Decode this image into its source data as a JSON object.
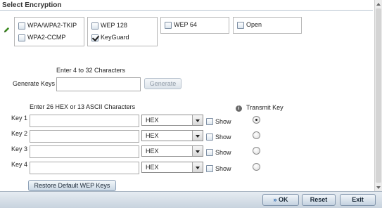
{
  "section": {
    "title": "Select Encryption"
  },
  "encryption": {
    "options": [
      {
        "label": "WPA/WPA2-TKIP",
        "checked": false
      },
      {
        "label": "WPA2-CCMP",
        "checked": false
      },
      {
        "label": "WEP 128",
        "checked": false
      },
      {
        "label": "KeyGuard",
        "checked": true
      },
      {
        "label": "WEP 64",
        "checked": false
      },
      {
        "label": "Open",
        "checked": false
      }
    ]
  },
  "generate": {
    "hint": "Enter 4 to 32 Characters",
    "label": "Generate Keys",
    "value": "",
    "button": "Generate"
  },
  "keys": {
    "hint": "Enter 26 HEX or 13 ASCII Characters",
    "transmit_label": "Transmit Key",
    "show_label": "Show",
    "rows": [
      {
        "label": "Key 1",
        "value": "",
        "format": "HEX",
        "show": false,
        "transmit": true
      },
      {
        "label": "Key 2",
        "value": "",
        "format": "HEX",
        "show": false,
        "transmit": false
      },
      {
        "label": "Key 3",
        "value": "",
        "format": "HEX",
        "show": false,
        "transmit": false
      },
      {
        "label": "Key 4",
        "value": "",
        "format": "HEX",
        "show": false,
        "transmit": false
      }
    ],
    "restore_button": "Restore Default WEP Keys"
  },
  "footer": {
    "ok": "OK",
    "reset": "Reset",
    "exit": "Exit"
  },
  "icons": {
    "edit": "pencil-icon",
    "info": "info-icon",
    "ok": "double-chevron-right-icon"
  },
  "colors": {
    "accent": "#c8d3de",
    "pencil": "#3a8a1e"
  }
}
